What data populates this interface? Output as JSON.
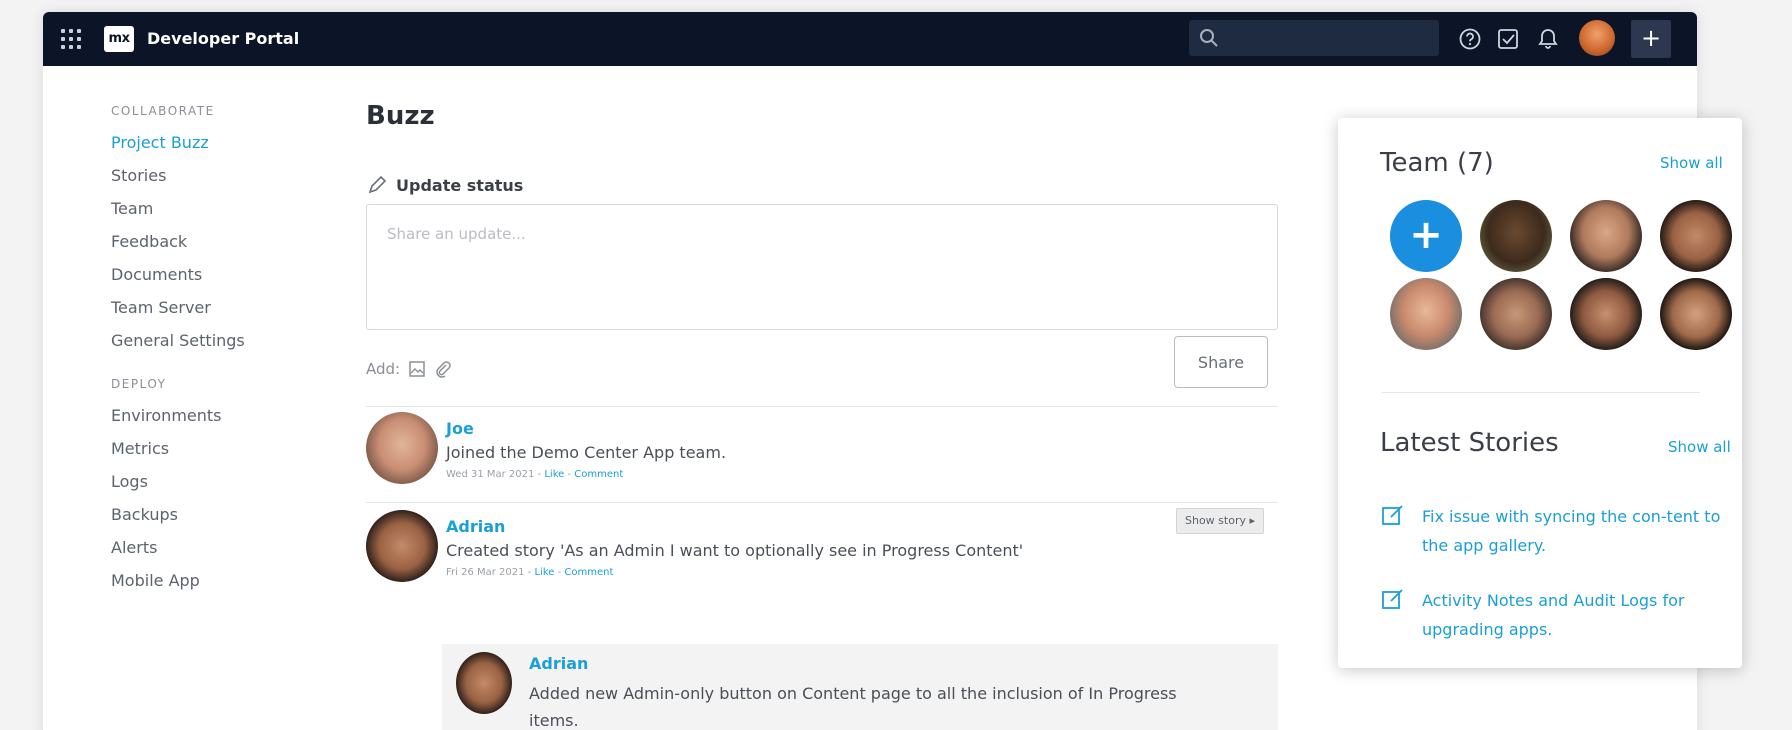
{
  "topbar": {
    "app_title": "Developer Portal",
    "logo_text": "mx",
    "search_placeholder": "",
    "icons": [
      "apps-grid-icon",
      "search-icon",
      "help-icon",
      "checkbox-icon",
      "bell-icon",
      "avatar",
      "plus-icon"
    ],
    "plus_label": "+"
  },
  "sidebar": {
    "collaborate_header": "COLLABORATE",
    "collaborate_items": [
      "Project Buzz",
      "Stories",
      "Team",
      "Feedback",
      "Documents",
      "Team Server",
      "General Settings"
    ],
    "deploy_header": "DEPLOY",
    "deploy_items": [
      "Environments",
      "Metrics",
      "Logs",
      "Backups",
      "Alerts",
      "Mobile App"
    ],
    "active_item": "Project Buzz"
  },
  "main": {
    "title": "Buzz",
    "update_status_label": "Update status",
    "status_placeholder": "Share an update...",
    "add_label": "Add:",
    "share_button": "Share",
    "show_story_label": "Show story ▸",
    "posts": [
      {
        "name": "Joe",
        "text": "Joined the Demo Center App team.",
        "date": "Wed 31 Mar 2021",
        "like": "Like",
        "comment": "Comment"
      },
      {
        "name": "Adrian",
        "text": "Created story 'As an Admin I want to optionally see in Progress Content'",
        "date": "Fri 26 Mar 2021",
        "like": "Like",
        "comment": "Comment"
      }
    ],
    "nested_post": {
      "name": "Adrian",
      "text": "Added new Admin-only button on Content page to all the inclusion of In Progress items."
    }
  },
  "team_card": {
    "team_title": "Team (7)",
    "team_show_all": "Show all",
    "add_member_label": "+",
    "latest_title": "Latest Stories",
    "latest_show_all": "Show all",
    "stories": [
      "Fix issue with syncing the con-tent to the app gallery.",
      "Activity Notes and Audit Logs for upgrading apps."
    ]
  },
  "colors": {
    "topbar": "#0b1527",
    "accent": "#1a9fd6",
    "add_member": "#1a8fe0"
  }
}
